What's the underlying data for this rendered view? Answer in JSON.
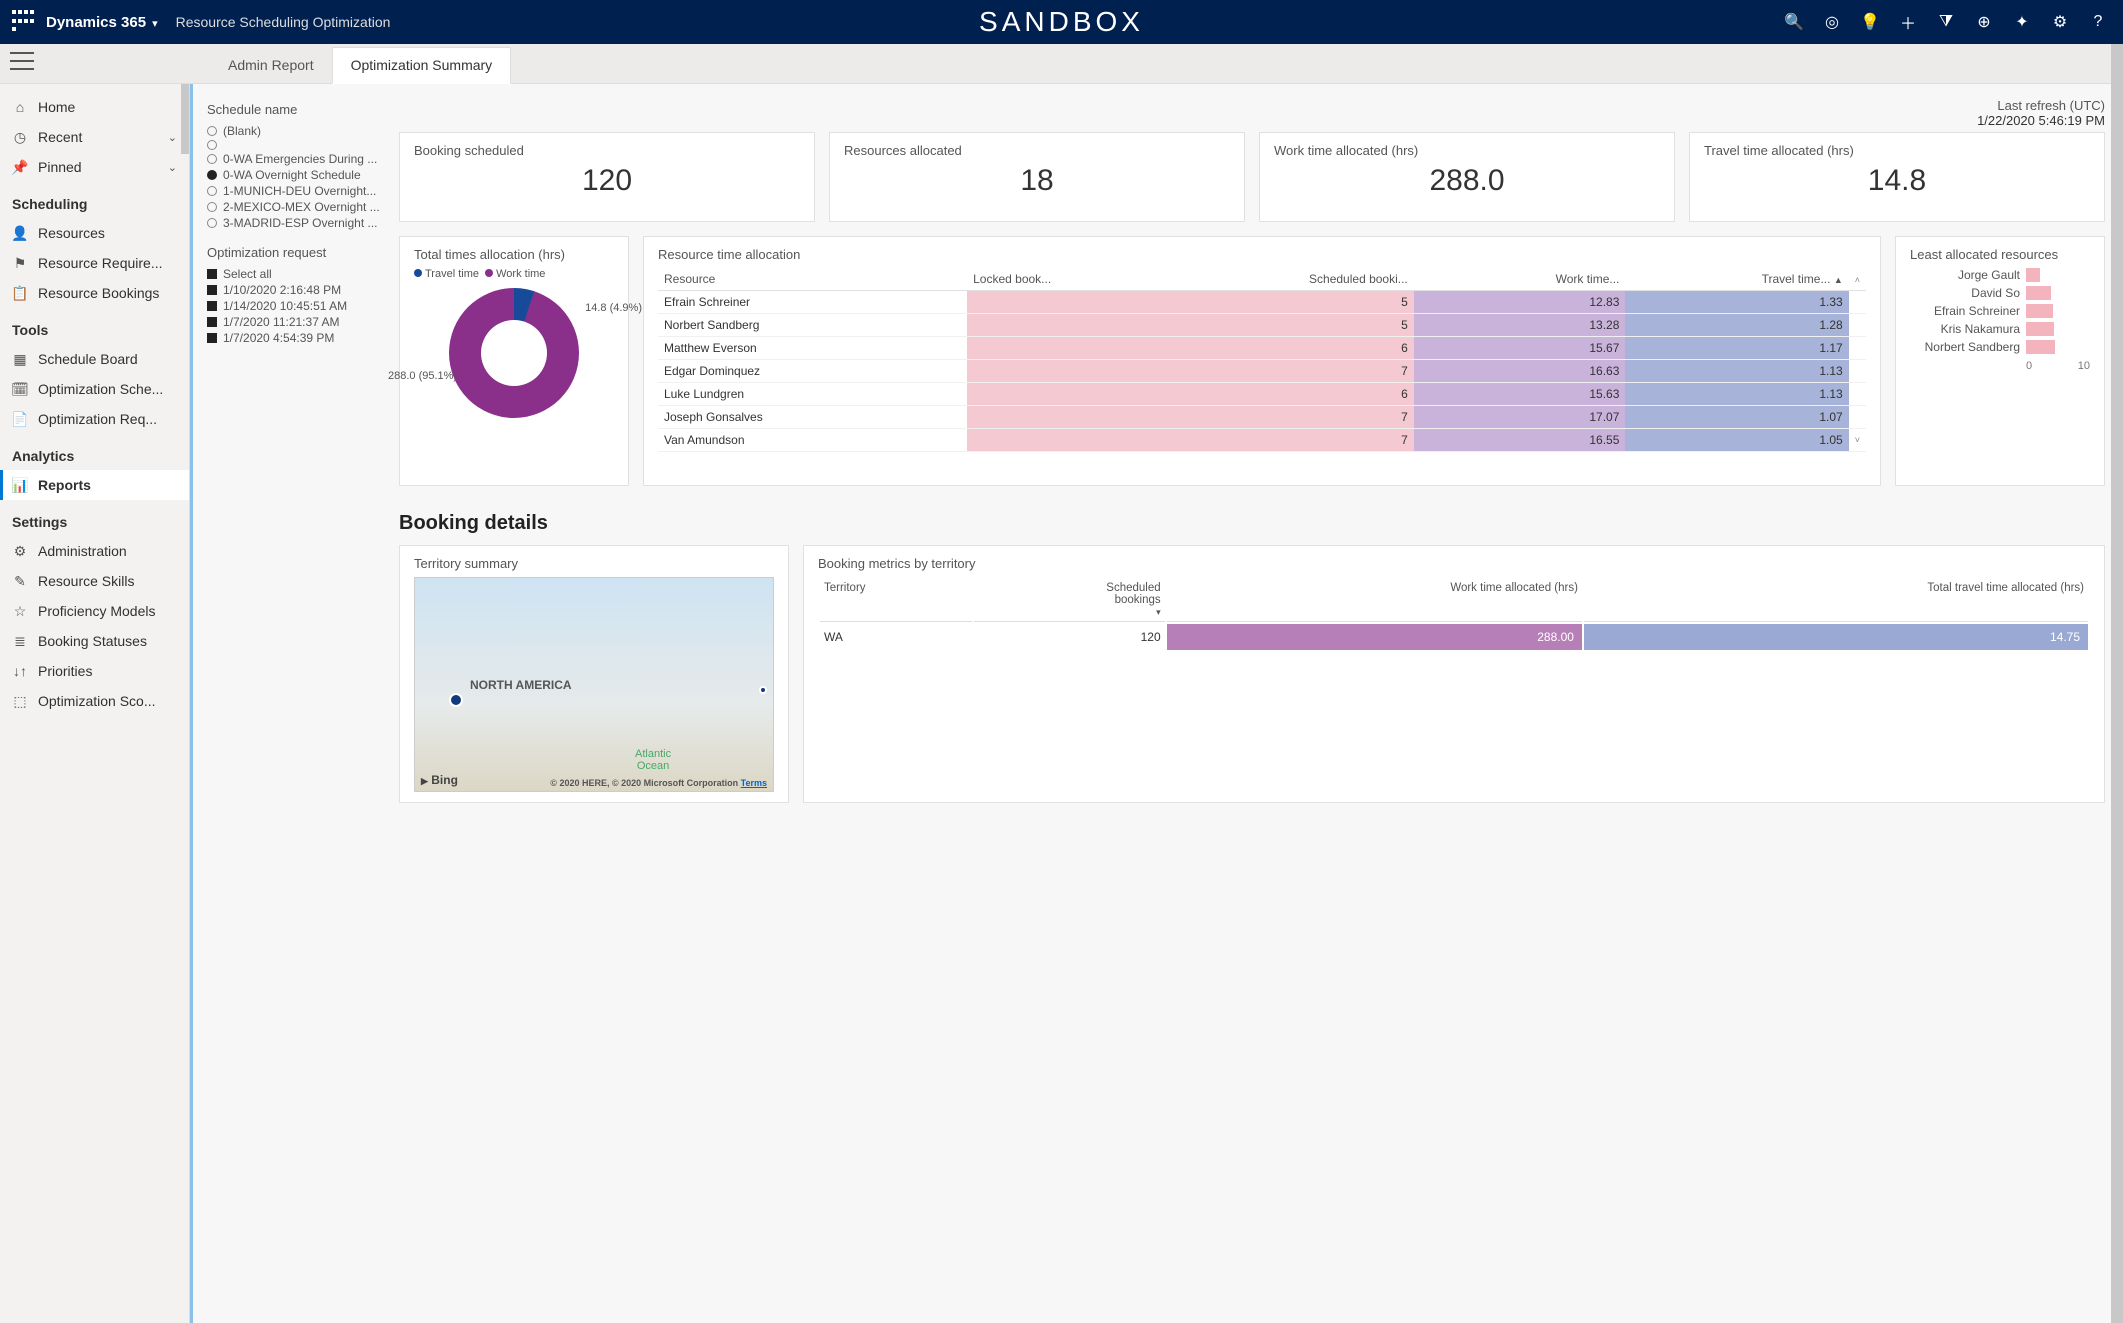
{
  "header": {
    "brand": "Dynamics 365",
    "app": "Resource Scheduling Optimization",
    "env": "SANDBOX",
    "icons": [
      "search",
      "target",
      "bulb",
      "plus",
      "funnel",
      "circle-plus",
      "sparkle",
      "gear",
      "help",
      "profile"
    ]
  },
  "tabs": {
    "items": [
      "Admin Report",
      "Optimization Summary"
    ],
    "active": 1
  },
  "sidebar": {
    "top": [
      {
        "icon": "home-icon",
        "label": "Home"
      },
      {
        "icon": "clock-icon",
        "label": "Recent",
        "chev": true
      },
      {
        "icon": "pin-icon",
        "label": "Pinned",
        "chev": true
      }
    ],
    "groups": [
      {
        "title": "Scheduling",
        "items": [
          {
            "icon": "resources-icon",
            "label": "Resources"
          },
          {
            "icon": "req-icon",
            "label": "Resource Require..."
          },
          {
            "icon": "bookings-icon",
            "label": "Resource Bookings"
          }
        ]
      },
      {
        "title": "Tools",
        "items": [
          {
            "icon": "board-icon",
            "label": "Schedule Board"
          },
          {
            "icon": "optsched-icon",
            "label": "Optimization Sche..."
          },
          {
            "icon": "optreq-icon",
            "label": "Optimization Req..."
          }
        ]
      },
      {
        "title": "Analytics",
        "items": [
          {
            "icon": "reports-icon",
            "label": "Reports",
            "active": true
          }
        ]
      },
      {
        "title": "Settings",
        "items": [
          {
            "icon": "gear-icon",
            "label": "Administration"
          },
          {
            "icon": "skills-icon",
            "label": "Resource Skills"
          },
          {
            "icon": "star-icon",
            "label": "Proficiency Models"
          },
          {
            "icon": "status-icon",
            "label": "Booking Statuses"
          },
          {
            "icon": "priority-icon",
            "label": "Priorities"
          },
          {
            "icon": "score-icon",
            "label": "Optimization Sco..."
          }
        ]
      }
    ]
  },
  "slicers": {
    "schedule": {
      "title": "Schedule name",
      "items": [
        {
          "label": "(Blank)",
          "sel": false
        },
        {
          "label": "",
          "sel": false
        },
        {
          "label": "0-WA Emergencies During ...",
          "sel": false
        },
        {
          "label": "0-WA Overnight Schedule",
          "sel": true
        },
        {
          "label": "1-MUNICH-DEU Overnight...",
          "sel": false
        },
        {
          "label": "2-MEXICO-MEX Overnight ...",
          "sel": false
        },
        {
          "label": "3-MADRID-ESP Overnight ...",
          "sel": false
        }
      ]
    },
    "request": {
      "title": "Optimization request",
      "items": [
        "Select all",
        "1/10/2020 2:16:48 PM",
        "1/14/2020 10:45:51 AM",
        "1/7/2020 11:21:37 AM",
        "1/7/2020 4:54:39 PM"
      ]
    }
  },
  "refresh": {
    "label": "Last refresh (UTC)",
    "value": "1/22/2020 5:46:19 PM"
  },
  "kpis": [
    {
      "label": "Booking scheduled",
      "value": "120"
    },
    {
      "label": "Resources allocated",
      "value": "18"
    },
    {
      "label": "Work time allocated (hrs)",
      "value": "288.0"
    },
    {
      "label": "Travel time allocated (hrs)",
      "value": "14.8"
    }
  ],
  "donut": {
    "title": "Total times allocation (hrs)",
    "legend": [
      {
        "label": "Travel time",
        "color": "#174a99"
      },
      {
        "label": "Work time",
        "color": "#8a2f8a"
      }
    ],
    "label1": "14.8 (4.9%)",
    "label2": "288.0 (95.1%)"
  },
  "resourceTable": {
    "title": "Resource time allocation",
    "headers": [
      "Resource",
      "Locked book...",
      "Scheduled booki...",
      "Work time...",
      "Travel time..."
    ],
    "rows": [
      {
        "r": "Efrain Schreiner",
        "l": "",
        "s": "5",
        "w": "12.83",
        "t": "1.33"
      },
      {
        "r": "Norbert Sandberg",
        "l": "",
        "s": "5",
        "w": "13.28",
        "t": "1.28"
      },
      {
        "r": "Matthew Everson",
        "l": "",
        "s": "6",
        "w": "15.67",
        "t": "1.17"
      },
      {
        "r": "Edgar Dominquez",
        "l": "",
        "s": "7",
        "w": "16.63",
        "t": "1.13"
      },
      {
        "r": "Luke Lundgren",
        "l": "",
        "s": "6",
        "w": "15.63",
        "t": "1.13"
      },
      {
        "r": "Joseph Gonsalves",
        "l": "",
        "s": "7",
        "w": "17.07",
        "t": "1.07"
      },
      {
        "r": "Van Amundson",
        "l": "",
        "s": "7",
        "w": "16.55",
        "t": "1.05"
      }
    ]
  },
  "leastAllocated": {
    "title": "Least allocated resources",
    "items": [
      {
        "name": "Jorge Gault",
        "val": 2.0
      },
      {
        "name": "David So",
        "val": 3.5
      },
      {
        "name": "Efrain Schreiner",
        "val": 3.8
      },
      {
        "name": "Kris Nakamura",
        "val": 4.0
      },
      {
        "name": "Norbert Sandberg",
        "val": 4.2
      }
    ],
    "axis": [
      "0",
      "10"
    ]
  },
  "details": {
    "heading": "Booking details",
    "territory": {
      "title": "Territory summary",
      "na": "NORTH AMERICA",
      "ocean": "Atlantic\nOcean",
      "bing": "Bing",
      "copy": "© 2020 HERE, © 2020 Microsoft Corporation",
      "terms": "Terms"
    },
    "metrics": {
      "title": "Booking metrics by territory",
      "headers": [
        "Territory",
        "Scheduled bookings",
        "Work time allocated (hrs)",
        "Total travel time allocated (hrs)"
      ],
      "rows": [
        {
          "t": "WA",
          "s": "120",
          "w": "288.00",
          "tt": "14.75"
        }
      ]
    }
  },
  "chart_data": [
    {
      "type": "pie",
      "title": "Total times allocation (hrs)",
      "categories": [
        "Travel time",
        "Work time"
      ],
      "values": [
        14.8,
        288.0
      ],
      "percentages": [
        4.9,
        95.1
      ],
      "colors": [
        "#174a99",
        "#8a2f8a"
      ]
    },
    {
      "type": "table",
      "title": "Resource time allocation",
      "columns": [
        "Resource",
        "Locked bookings",
        "Scheduled bookings",
        "Work time (hrs)",
        "Travel time (hrs)"
      ],
      "rows": [
        [
          "Efrain Schreiner",
          null,
          5,
          12.83,
          1.33
        ],
        [
          "Norbert Sandberg",
          null,
          5,
          13.28,
          1.28
        ],
        [
          "Matthew Everson",
          null,
          6,
          15.67,
          1.17
        ],
        [
          "Edgar Dominquez",
          null,
          7,
          16.63,
          1.13
        ],
        [
          "Luke Lundgren",
          null,
          6,
          15.63,
          1.13
        ],
        [
          "Joseph Gonsalves",
          null,
          7,
          17.07,
          1.07
        ],
        [
          "Van Amundson",
          null,
          7,
          16.55,
          1.05
        ]
      ]
    },
    {
      "type": "bar",
      "title": "Least allocated resources",
      "orientation": "horizontal",
      "categories": [
        "Jorge Gault",
        "David So",
        "Efrain Schreiner",
        "Kris Nakamura",
        "Norbert Sandberg"
      ],
      "values": [
        2.0,
        3.5,
        3.8,
        4.0,
        4.2
      ],
      "xlabel": "",
      "ylabel": "",
      "xlim": [
        0,
        10
      ],
      "color": "#f3b4be"
    },
    {
      "type": "table",
      "title": "Booking metrics by territory",
      "columns": [
        "Territory",
        "Scheduled bookings",
        "Work time allocated (hrs)",
        "Total travel time allocated (hrs)"
      ],
      "rows": [
        [
          "WA",
          120,
          288.0,
          14.75
        ]
      ]
    }
  ]
}
